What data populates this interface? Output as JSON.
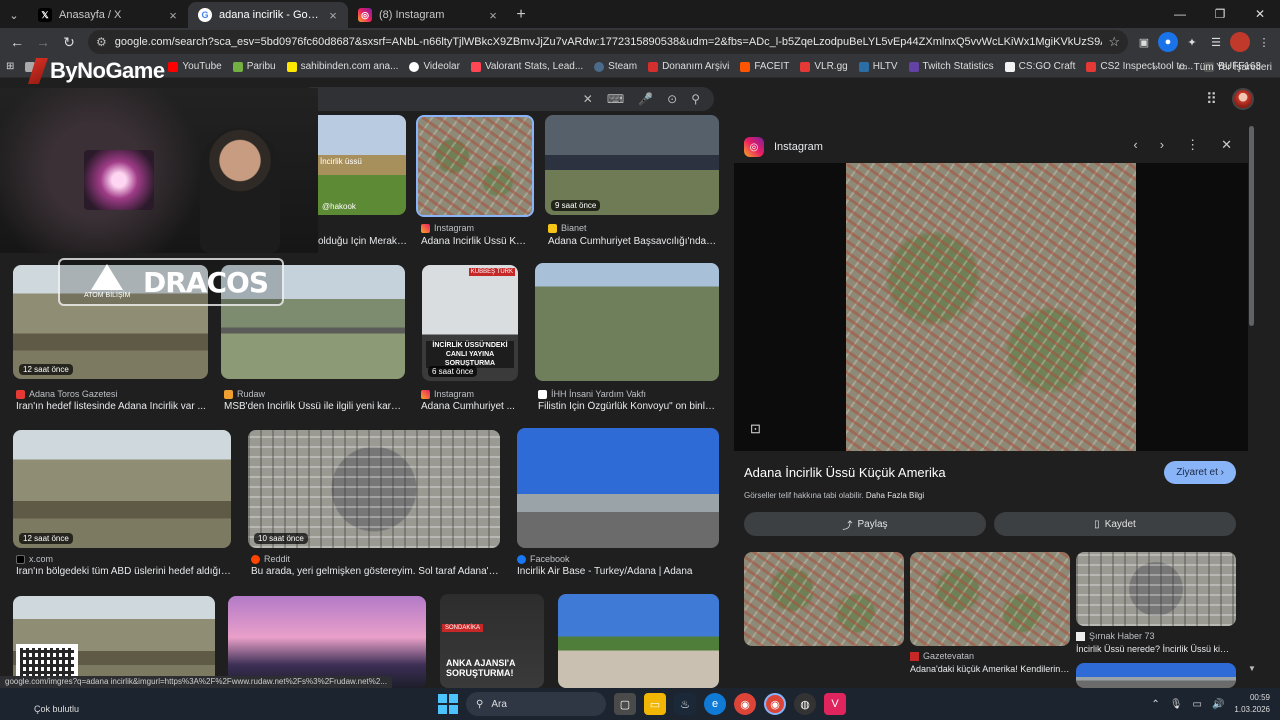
{
  "tabs": [
    {
      "title": "Anasayfa / X",
      "icon": "x-logo-icon",
      "active": false
    },
    {
      "title": "adana incirlik - Google'da Ara",
      "icon": "google-icon",
      "active": true
    },
    {
      "title": "(8) Instagram",
      "icon": "instagram-icon",
      "active": false
    }
  ],
  "address": {
    "url": "google.com/search?sca_esv=5bd0976fc60d8687&sxsrf=ANbL-n66ltyTjlWBkcX9ZBmvJjZu7vARdw:1772315890538&udm=2&fbs=ADc_l-b5ZqeLzodpuBeLYL5vEp44ZXmlnxQ5vvWcLKiWx1MgiKVkUzS9ASKuzjegOFWQJNUoF04SQu7bZ-GdO..."
  },
  "bookmarks": [
    {
      "label": "",
      "color": "#aaa"
    },
    {
      "label": "YouTube",
      "color": "#ff0000"
    },
    {
      "label": "Paribu",
      "color": "#72b043"
    },
    {
      "label": "sahibinden.com ana...",
      "color": "#ffe800"
    },
    {
      "label": "Videolar",
      "color": "#ffffff"
    },
    {
      "label": "Valorant Stats, Lead...",
      "color": "#ff4655"
    },
    {
      "label": "Steam",
      "color": "#1b2838"
    },
    {
      "label": "Donanım Arşivi",
      "color": "#d32f2f"
    },
    {
      "label": "FACEIT",
      "color": "#ff5500"
    },
    {
      "label": "VLR.gg",
      "color": "#e53935"
    },
    {
      "label": "HLTV",
      "color": "#2b6ea6"
    },
    {
      "label": "Twitch Statistics",
      "color": "#6441a5"
    },
    {
      "label": "CS:GO Craft",
      "color": "#f2f2f2"
    },
    {
      "label": "CS2 Inspect tool to...",
      "color": "#e53935"
    },
    {
      "label": "BUFF163",
      "color": "#333"
    }
  ],
  "bookmarks_all": "Tüm Yer İşaretleri",
  "stream_logo": "ByNoGame",
  "sponsor": {
    "left": "ATOM BİLİŞİM",
    "right": "DRACOS"
  },
  "results": [
    {
      "source": "",
      "caption": "İr",
      "age": ""
    },
    {
      "source": "",
      "caption": "olduğu İçin Merak ...",
      "age": "",
      "overlay": "İncirlik üssü",
      "handle": "@hakook"
    },
    {
      "source": "Instagram",
      "caption": "Adana İncirlik Üssü Kü...",
      "age": ""
    },
    {
      "source": "Bianet",
      "caption": "Adana Cumhuriyet Başsavcılığı'ndan...",
      "age": "9 saat önce"
    },
    {
      "source": "Adana Toros Gazetesi",
      "caption": "İran'ın hedef listesinde Adana İncirlik var ...",
      "age": "12 saat önce"
    },
    {
      "source": "Rudaw",
      "caption": "MSB'den İncirlik Üssü ile ilgili yeni kara...",
      "age": ""
    },
    {
      "source": "Instagram",
      "caption": "Adana Cumhuriyet ...",
      "age": "6 saat önce",
      "overlay": "İNCİRLİK ÜSSÜ'NDEKİ CANLI YAYINA SORUŞTURMA",
      "badge": "KUBBEŞ TÜRK"
    },
    {
      "source": "İHH İnsani Yardım Vakfı",
      "caption": "Filistin İçin Özgürlük Konvoyu\" on binle...",
      "age": ""
    },
    {
      "source": "x.com",
      "caption": "İran'ın bölgedeki tüm ABD üslerini hedef aldığı k...",
      "age": "12 saat önce"
    },
    {
      "source": "Reddit",
      "caption": "Bu arada, yeri gelmişken göstereyim. Sol taraf Adana'd...",
      "age": "10 saat önce"
    },
    {
      "source": "Facebook",
      "caption": "İncirlik Air Base - Turkey/Adana | Adana",
      "age": ""
    },
    {
      "overlay": "ANKA AJANSI'A SORUŞTURMA!",
      "badge": "SONDAKİKA"
    }
  ],
  "panel": {
    "source": "Instagram",
    "title": "Adana İncirlik Üssü Küçük Amerika",
    "visit": "Ziyaret et",
    "note": "Görseller telif hakkına tabi olabilir.",
    "note_link": "Daha Fazla Bilgi",
    "share": "Paylaş",
    "save": "Kaydet",
    "related": [
      {
        "source": "",
        "caption": ""
      },
      {
        "source": "Gazetevatan",
        "caption": "Adana'daki küçük Amerika! Kendilerine..."
      },
      {
        "source": "Şırnak Haber 73",
        "caption": "İncirlik Üssü nerede? İncirlik Üssü kimin..."
      }
    ]
  },
  "status_url": "google.com/imgres?q=adana incirlik&imgurl=https%3A%2F%2Fwww.rudaw.net%2Fs%3%2Frudaw.net%2...",
  "taskbar": {
    "weather": "Çok bulutlu",
    "search": "Ara",
    "time": "00:59",
    "date": "1.03.2026"
  }
}
